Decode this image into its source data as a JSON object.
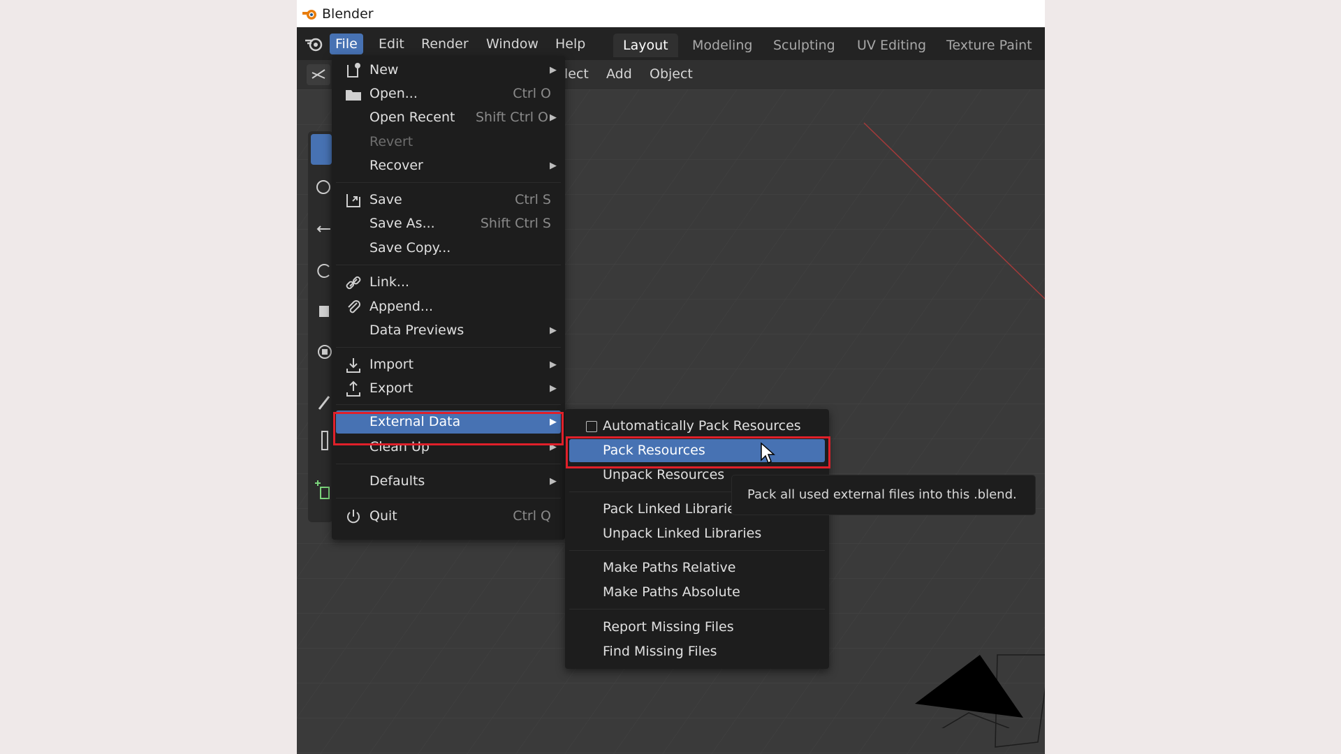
{
  "window": {
    "title": "Blender"
  },
  "topbar": {
    "menus": [
      "File",
      "Edit",
      "Render",
      "Window",
      "Help"
    ],
    "workspaces": [
      "Layout",
      "Modeling",
      "Sculpting",
      "UV Editing",
      "Texture Paint"
    ],
    "active_workspace": "Layout"
  },
  "viewport_header": {
    "items": [
      "lect",
      "Add",
      "Object"
    ]
  },
  "file_menu": {
    "items": [
      {
        "label": "New",
        "shortcut": "",
        "submenu": true,
        "icon": "new-file-icon"
      },
      {
        "label": "Open...",
        "shortcut": "Ctrl O",
        "submenu": false,
        "icon": "folder-icon"
      },
      {
        "label": "Open Recent",
        "shortcut": "Shift Ctrl O",
        "submenu": true,
        "icon": ""
      },
      {
        "label": "Revert",
        "shortcut": "",
        "submenu": false,
        "icon": "",
        "disabled": true
      },
      {
        "label": "Recover",
        "shortcut": "",
        "submenu": true,
        "icon": ""
      },
      {
        "label": "Save",
        "shortcut": "Ctrl S",
        "submenu": false,
        "icon": "save-icon"
      },
      {
        "label": "Save As...",
        "shortcut": "Shift Ctrl S",
        "submenu": false,
        "icon": ""
      },
      {
        "label": "Save Copy...",
        "shortcut": "",
        "submenu": false,
        "icon": ""
      },
      {
        "label": "Link...",
        "shortcut": "",
        "submenu": false,
        "icon": "link-icon"
      },
      {
        "label": "Append...",
        "shortcut": "",
        "submenu": false,
        "icon": "paperclip-icon"
      },
      {
        "label": "Data Previews",
        "shortcut": "",
        "submenu": true,
        "icon": ""
      },
      {
        "label": "Import",
        "shortcut": "",
        "submenu": true,
        "icon": "import-icon"
      },
      {
        "label": "Export",
        "shortcut": "",
        "submenu": true,
        "icon": "export-icon"
      },
      {
        "label": "External Data",
        "shortcut": "",
        "submenu": true,
        "icon": "",
        "highlighted": true
      },
      {
        "label": "Clean Up",
        "shortcut": "",
        "submenu": true,
        "icon": ""
      },
      {
        "label": "Defaults",
        "shortcut": "",
        "submenu": true,
        "icon": ""
      },
      {
        "label": "Quit",
        "shortcut": "Ctrl Q",
        "submenu": false,
        "icon": "power-icon"
      }
    ]
  },
  "external_data_menu": {
    "items": [
      {
        "label": "Automatically Pack Resources",
        "checkbox": true,
        "checked": false
      },
      {
        "label": "Pack Resources",
        "highlighted": true
      },
      {
        "label": "Unpack Resources"
      },
      {
        "label": "Pack Linked Libraries"
      },
      {
        "label": "Unpack Linked Libraries"
      },
      {
        "label": "Make Paths Relative"
      },
      {
        "label": "Make Paths Absolute"
      },
      {
        "label": "Report Missing Files"
      },
      {
        "label": "Find Missing Files"
      }
    ]
  },
  "tooltip": {
    "text": "Pack all used external files into this .blend."
  },
  "colors": {
    "highlight": "#4772b3",
    "annotation_red": "#e0202a",
    "menu_bg": "#1d1d1d"
  }
}
